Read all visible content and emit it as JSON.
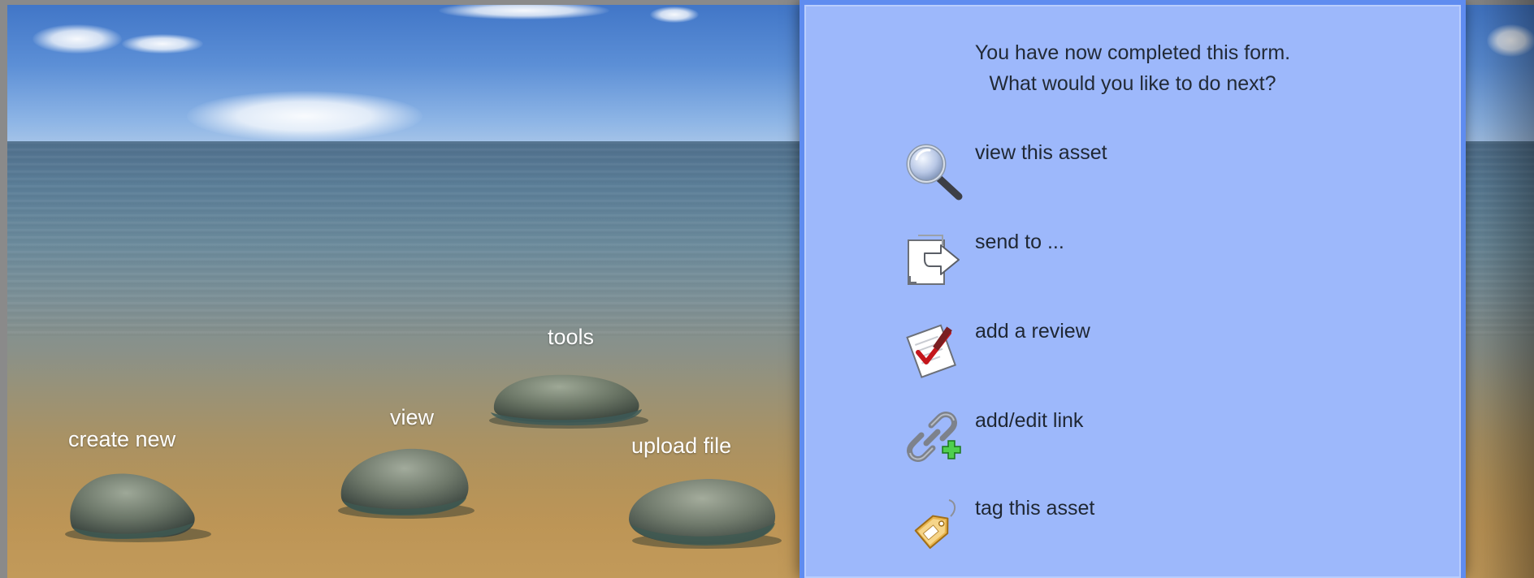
{
  "stones": {
    "create_new": "create new",
    "view": "view",
    "tools": "tools",
    "upload_file": "upload file"
  },
  "dialog": {
    "message_line1": "You have now completed this form.",
    "message_line2": "What would you like to do next?",
    "actions": [
      {
        "label": "view this asset",
        "icon": "magnifier-icon"
      },
      {
        "label": "send to ...",
        "icon": "send-document-icon"
      },
      {
        "label": "add a review",
        "icon": "review-checkmark-icon"
      },
      {
        "label": "add/edit link",
        "icon": "chain-link-add-icon"
      },
      {
        "label": "tag this asset",
        "icon": "price-tag-icon"
      }
    ]
  },
  "colors": {
    "dialog_bg": "#9db8fb",
    "dialog_border": "#5f8cf0",
    "sky": "#4f84d0",
    "sand": "#c29a5a"
  }
}
